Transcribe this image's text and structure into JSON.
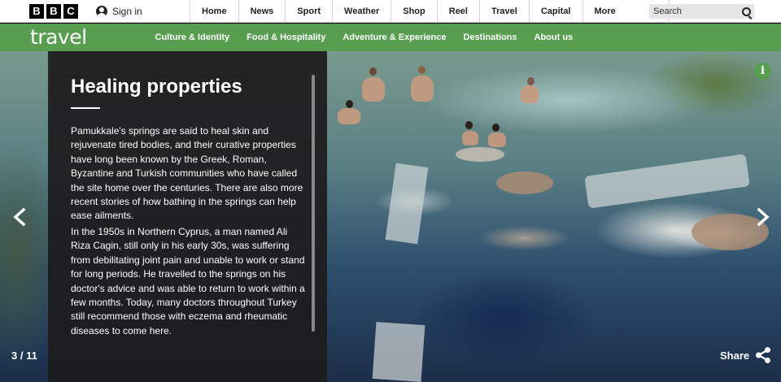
{
  "header": {
    "logo_letters": [
      "B",
      "B",
      "C"
    ],
    "signin_label": "Sign in",
    "nav_items": [
      "Home",
      "News",
      "Sport",
      "Weather",
      "Shop",
      "Reel",
      "Travel",
      "Capital"
    ],
    "more_label": "More",
    "search_placeholder": "Search"
  },
  "subnav": {
    "brand": "travel",
    "brand_color": "#589e50",
    "sections": [
      "Culture & Identity",
      "Food & Hospitality",
      "Adventure & Experience",
      "Destinations",
      "About us"
    ]
  },
  "gallery": {
    "title": "Healing properties",
    "paragraphs": [
      "Pamukkale's springs are said to heal skin and rejuvenate tired bodies, and their curative properties have long been known by the Greek, Roman, Byzantine and Turkish communities who have called the site home over the centuries. There are also more recent stories of how bathing in the springs can help ease ailments.",
      "In the 1950s in Northern Cyprus, a man named Ali Riza Cagin, still only in his early 30s, was suffering from debilitating joint pain and unable to work or stand for long periods. He travelled to the springs on his doctor's advice and was able to return to work within a few months. Today, many doctors throughout Turkey still recommend those with eczema and rheumatic diseases to come here."
    ],
    "counter": "3 / 11",
    "share_label": "Share",
    "info_glyph": "i",
    "icons": {
      "prev": "chevron-left-icon",
      "next": "chevron-right-icon",
      "share": "share-icon",
      "info": "info-icon"
    }
  }
}
